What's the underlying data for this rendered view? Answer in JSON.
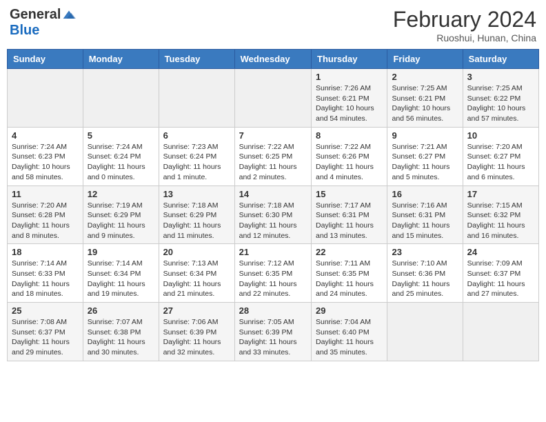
{
  "header": {
    "logo_general": "General",
    "logo_blue": "Blue",
    "month_year": "February 2024",
    "location": "Ruoshui, Hunan, China"
  },
  "days_of_week": [
    "Sunday",
    "Monday",
    "Tuesday",
    "Wednesday",
    "Thursday",
    "Friday",
    "Saturday"
  ],
  "weeks": [
    [
      {
        "day": "",
        "info": ""
      },
      {
        "day": "",
        "info": ""
      },
      {
        "day": "",
        "info": ""
      },
      {
        "day": "",
        "info": ""
      },
      {
        "day": "1",
        "info": "Sunrise: 7:26 AM\nSunset: 6:21 PM\nDaylight: 10 hours and 54 minutes."
      },
      {
        "day": "2",
        "info": "Sunrise: 7:25 AM\nSunset: 6:21 PM\nDaylight: 10 hours and 56 minutes."
      },
      {
        "day": "3",
        "info": "Sunrise: 7:25 AM\nSunset: 6:22 PM\nDaylight: 10 hours and 57 minutes."
      }
    ],
    [
      {
        "day": "4",
        "info": "Sunrise: 7:24 AM\nSunset: 6:23 PM\nDaylight: 10 hours and 58 minutes."
      },
      {
        "day": "5",
        "info": "Sunrise: 7:24 AM\nSunset: 6:24 PM\nDaylight: 11 hours and 0 minutes."
      },
      {
        "day": "6",
        "info": "Sunrise: 7:23 AM\nSunset: 6:24 PM\nDaylight: 11 hours and 1 minute."
      },
      {
        "day": "7",
        "info": "Sunrise: 7:22 AM\nSunset: 6:25 PM\nDaylight: 11 hours and 2 minutes."
      },
      {
        "day": "8",
        "info": "Sunrise: 7:22 AM\nSunset: 6:26 PM\nDaylight: 11 hours and 4 minutes."
      },
      {
        "day": "9",
        "info": "Sunrise: 7:21 AM\nSunset: 6:27 PM\nDaylight: 11 hours and 5 minutes."
      },
      {
        "day": "10",
        "info": "Sunrise: 7:20 AM\nSunset: 6:27 PM\nDaylight: 11 hours and 6 minutes."
      }
    ],
    [
      {
        "day": "11",
        "info": "Sunrise: 7:20 AM\nSunset: 6:28 PM\nDaylight: 11 hours and 8 minutes."
      },
      {
        "day": "12",
        "info": "Sunrise: 7:19 AM\nSunset: 6:29 PM\nDaylight: 11 hours and 9 minutes."
      },
      {
        "day": "13",
        "info": "Sunrise: 7:18 AM\nSunset: 6:29 PM\nDaylight: 11 hours and 11 minutes."
      },
      {
        "day": "14",
        "info": "Sunrise: 7:18 AM\nSunset: 6:30 PM\nDaylight: 11 hours and 12 minutes."
      },
      {
        "day": "15",
        "info": "Sunrise: 7:17 AM\nSunset: 6:31 PM\nDaylight: 11 hours and 13 minutes."
      },
      {
        "day": "16",
        "info": "Sunrise: 7:16 AM\nSunset: 6:31 PM\nDaylight: 11 hours and 15 minutes."
      },
      {
        "day": "17",
        "info": "Sunrise: 7:15 AM\nSunset: 6:32 PM\nDaylight: 11 hours and 16 minutes."
      }
    ],
    [
      {
        "day": "18",
        "info": "Sunrise: 7:14 AM\nSunset: 6:33 PM\nDaylight: 11 hours and 18 minutes."
      },
      {
        "day": "19",
        "info": "Sunrise: 7:14 AM\nSunset: 6:34 PM\nDaylight: 11 hours and 19 minutes."
      },
      {
        "day": "20",
        "info": "Sunrise: 7:13 AM\nSunset: 6:34 PM\nDaylight: 11 hours and 21 minutes."
      },
      {
        "day": "21",
        "info": "Sunrise: 7:12 AM\nSunset: 6:35 PM\nDaylight: 11 hours and 22 minutes."
      },
      {
        "day": "22",
        "info": "Sunrise: 7:11 AM\nSunset: 6:35 PM\nDaylight: 11 hours and 24 minutes."
      },
      {
        "day": "23",
        "info": "Sunrise: 7:10 AM\nSunset: 6:36 PM\nDaylight: 11 hours and 25 minutes."
      },
      {
        "day": "24",
        "info": "Sunrise: 7:09 AM\nSunset: 6:37 PM\nDaylight: 11 hours and 27 minutes."
      }
    ],
    [
      {
        "day": "25",
        "info": "Sunrise: 7:08 AM\nSunset: 6:37 PM\nDaylight: 11 hours and 29 minutes."
      },
      {
        "day": "26",
        "info": "Sunrise: 7:07 AM\nSunset: 6:38 PM\nDaylight: 11 hours and 30 minutes."
      },
      {
        "day": "27",
        "info": "Sunrise: 7:06 AM\nSunset: 6:39 PM\nDaylight: 11 hours and 32 minutes."
      },
      {
        "day": "28",
        "info": "Sunrise: 7:05 AM\nSunset: 6:39 PM\nDaylight: 11 hours and 33 minutes."
      },
      {
        "day": "29",
        "info": "Sunrise: 7:04 AM\nSunset: 6:40 PM\nDaylight: 11 hours and 35 minutes."
      },
      {
        "day": "",
        "info": ""
      },
      {
        "day": "",
        "info": ""
      }
    ]
  ]
}
